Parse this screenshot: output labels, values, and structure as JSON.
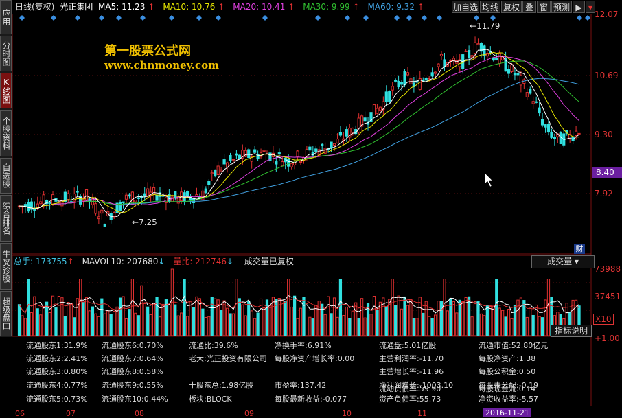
{
  "sidebar": {
    "tabs": [
      "应用",
      "分时图",
      "K线图",
      "个股资料",
      "自选股",
      "综合排名",
      "牛叉诊股",
      "超级盘口"
    ],
    "active_index": 2
  },
  "header": {
    "period": "日线(复权)",
    "stock_name": "光正集团",
    "ma5": "MA5: 11.23",
    "ma10": "MA10: 10.76",
    "ma20": "MA20: 10.41",
    "ma30": "MA30: 9.99",
    "ma60": "MA60: 9.32",
    "buttons": [
      "加自选",
      "均线",
      "复权",
      "叠",
      "窗",
      "预测"
    ]
  },
  "watermark": {
    "line1": "第一股票公式网",
    "line2": "www.chnmoney.com"
  },
  "price_axis": {
    "labels": [
      "12.07",
      "10.69",
      "9.30",
      "7.92"
    ],
    "current_price": "8.40",
    "fin_icon": "财"
  },
  "annotations": {
    "high": "11.79",
    "low": "7.25"
  },
  "volume_header": {
    "total": "总手: 173755",
    "mavol": "MAVOL10: 207680",
    "ratio": "量比: 212746",
    "note": "成交量已复权",
    "selector": "成交量"
  },
  "volume_axis": {
    "labels": [
      "73988",
      "37451",
      "X10"
    ]
  },
  "indicator_button": "指标说明",
  "indicator_axis": "+1.00",
  "info_rows": [
    [
      "流通股东1:31.9%",
      "流通股东6:0.70%",
      "流通比:39.6%",
      "净换手率:6.91%",
      "流通盘:5.01亿股",
      "流通市值:52.80亿元"
    ],
    [
      "流通股东2:2.41%",
      "流通股东7:0.64%",
      "老大:光正投资有限公司",
      "每股净资产增长率:0.00",
      "主营利润率:-11.70",
      "每股净资产:1.38"
    ],
    [
      "流通股东3:0.80%",
      "流通股东8:0.58%",
      "",
      "",
      "主营增长率:-11.96",
      "每股公积金:0.50"
    ],
    [
      "流通股东4:0.77%",
      "流通股东9:0.55%",
      "十股东总:1.98亿股",
      "市盈率:137.42",
      "净利润增长:-1003.10",
      "每股未分配:-0.19"
    ],
    [
      "流通股东5:0.73%",
      "流通股东10:0.44%",
      "板块:BLOCK",
      "每股最新收益:-0.077",
      "资产负债率:55.73",
      "净资收益率:-5.57"
    ]
  ],
  "extra_info": {
    "cash_flow": "每股现金流:0.14",
    "flow_ratio": "流动负债率:59.90"
  },
  "dates": [
    "06",
    "07",
    "08",
    "09",
    "10",
    "11",
    "2016-11-21"
  ],
  "colors": {
    "up": "#e03030",
    "down": "#30e0e0",
    "ma5": "#ffffff",
    "ma10": "#e8e800",
    "ma20": "#e040e0",
    "ma30": "#30c030",
    "ma60": "#40a0e0",
    "highlight": "#6b1fa0"
  }
}
